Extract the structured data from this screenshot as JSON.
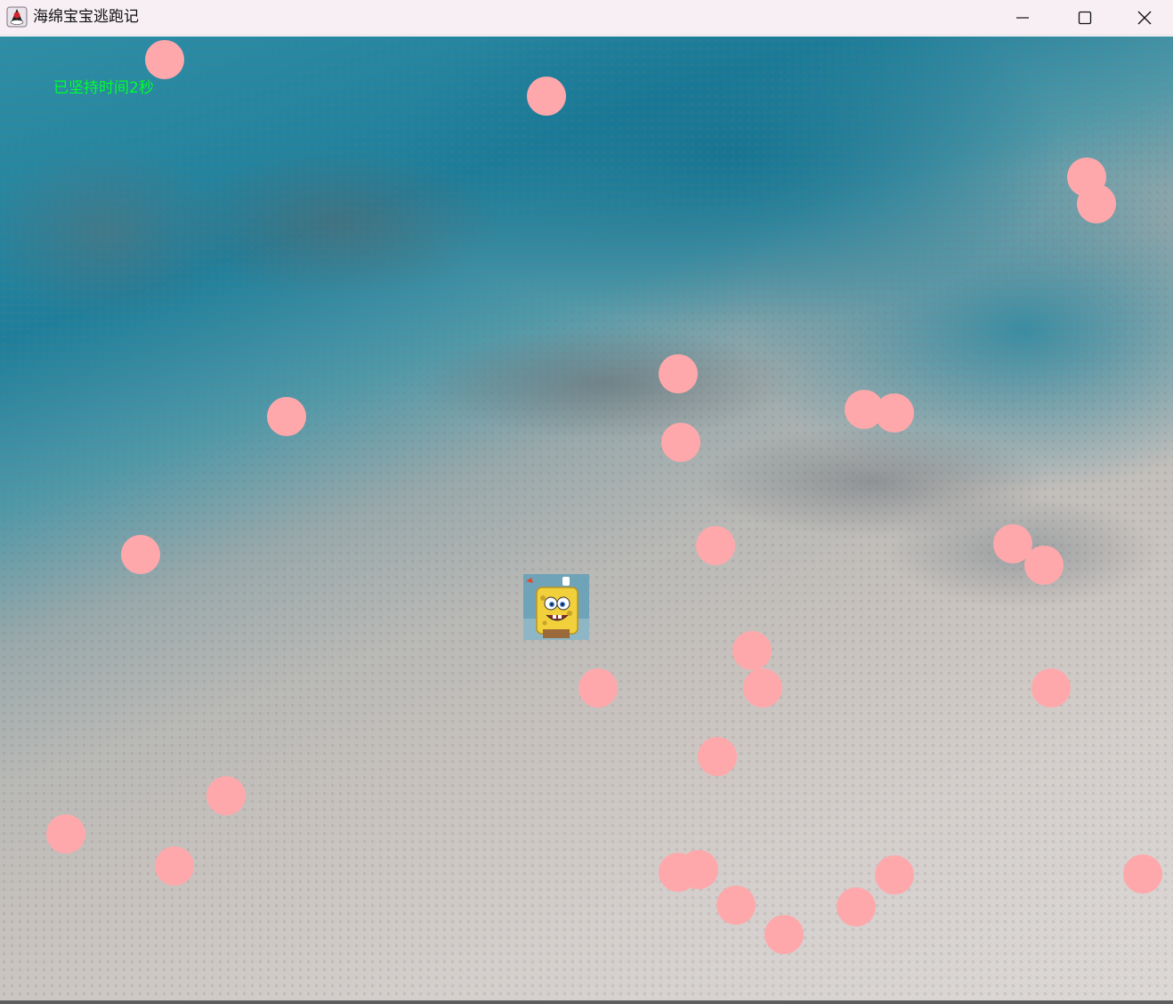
{
  "window": {
    "title": "海绵宝宝逃跑记",
    "controls": [
      "minimize",
      "maximize",
      "close"
    ]
  },
  "hud": {
    "timer_text": "已坚持时间2秒"
  },
  "colors": {
    "ball": "#ffa8ab",
    "timer": "#00ff2a",
    "titlebar": "#f7eff4"
  },
  "icons": {
    "app": "java-duke-icon",
    "minimize": "minimize-icon",
    "maximize": "maximize-icon",
    "close": "close-icon",
    "player": "spongebob-sprite"
  }
}
